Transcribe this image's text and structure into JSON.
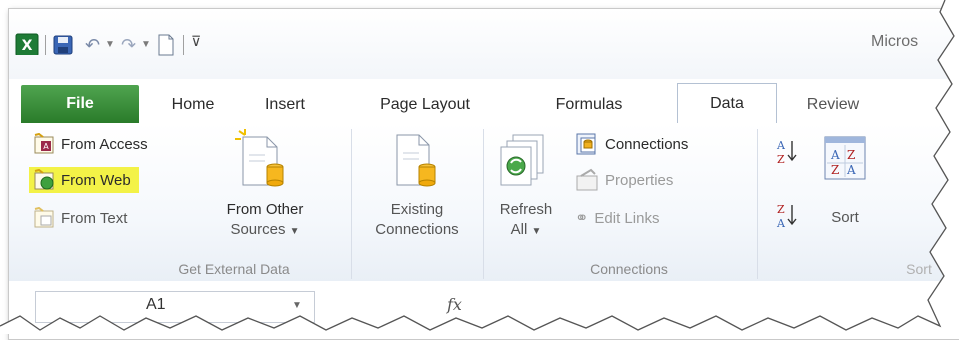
{
  "title": "Micros",
  "qat": {
    "icons": [
      "excel-icon",
      "save-icon",
      "undo-icon",
      "redo-icon",
      "new-document-icon",
      "customize-qat-icon"
    ]
  },
  "tabs": [
    {
      "label": "File"
    },
    {
      "label": "Home"
    },
    {
      "label": "Insert"
    },
    {
      "label": "Page Layout"
    },
    {
      "label": "Formulas"
    },
    {
      "label": "Data"
    },
    {
      "label": "Review"
    }
  ],
  "ribbon": {
    "get_external": {
      "from_access": "From Access",
      "from_web": "From Web",
      "from_text": "From Text",
      "from_other_line1": "From Other",
      "from_other_line2": "Sources",
      "label": "Get External Data"
    },
    "existing": {
      "line1": "Existing",
      "line2": "Connections"
    },
    "connections": {
      "refresh_line1": "Refresh",
      "refresh_line2": "All",
      "connections": "Connections",
      "properties": "Properties",
      "edit_links": "Edit Links",
      "label": "Connections"
    },
    "sort": {
      "sort": "Sort",
      "label": "Sort"
    }
  },
  "formula_bar": {
    "name_box": "A1",
    "fx": "fx"
  },
  "colors": {
    "file_tab": "#2a7b2a",
    "highlight": "#f3f247"
  }
}
